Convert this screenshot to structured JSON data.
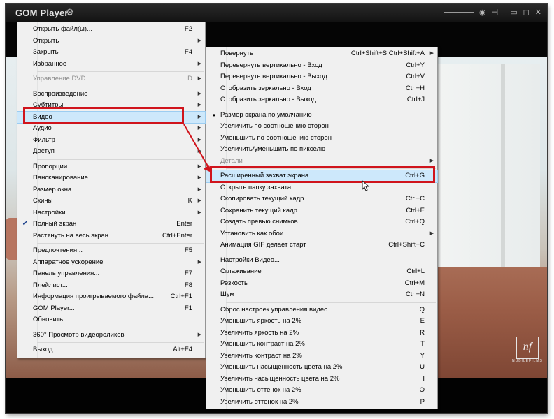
{
  "titlebar": {
    "app_title": "GOM Player",
    "settings_icon": "gear-icon",
    "controls": [
      "volume-slider",
      "audio-icon",
      "pin-icon",
      "minimize-icon",
      "maximize-icon",
      "close-icon"
    ]
  },
  "colors": {
    "annotation_red": "#d0141c",
    "menu_bg": "#f0f0f0",
    "highlight_bg": "#cde8fb"
  },
  "watermark": {
    "mark": "nf",
    "text": "NUBILEFILMS"
  },
  "main_menu": {
    "items": [
      {
        "label": "Открыть файл(ы)...",
        "shortcut": "F2"
      },
      {
        "label": "Открыть",
        "submenu": true
      },
      {
        "label": "Закрыть",
        "shortcut": "F4"
      },
      {
        "label": "Избранное",
        "submenu": true
      },
      {
        "separator": true
      },
      {
        "label": "Управление DVD",
        "shortcut": "D",
        "disabled": true,
        "submenu": true
      },
      {
        "separator": true
      },
      {
        "label": "Воспроизведение",
        "submenu": true
      },
      {
        "label": "Субтитры",
        "submenu": true
      },
      {
        "label": "Видео",
        "submenu": true,
        "highlighted": true
      },
      {
        "label": "Аудио",
        "submenu": true
      },
      {
        "label": "Фильтр",
        "submenu": true
      },
      {
        "label": "Доступ",
        "submenu": true
      },
      {
        "separator": true
      },
      {
        "label": "Пропорции",
        "submenu": true
      },
      {
        "label": "Пансканирование",
        "submenu": true
      },
      {
        "label": "Размер окна",
        "submenu": true
      },
      {
        "label": "Скины",
        "shortcut": "K",
        "submenu": true
      },
      {
        "label": "Настройки",
        "submenu": true
      },
      {
        "label": "Полный экран",
        "shortcut": "Enter",
        "checked": true
      },
      {
        "label": "Растянуть на весь экран",
        "shortcut": "Ctrl+Enter"
      },
      {
        "separator": true
      },
      {
        "label": "Предпочтения...",
        "shortcut": "F5"
      },
      {
        "label": "Аппаратное ускорение",
        "submenu": true
      },
      {
        "label": "Панель управления...",
        "shortcut": "F7"
      },
      {
        "label": "Плейлист...",
        "shortcut": "F8"
      },
      {
        "label": "Информация проигрываемого файла...",
        "shortcut": "Ctrl+F1"
      },
      {
        "label": "GOM Player...",
        "shortcut": "F1"
      },
      {
        "label": "Обновить"
      },
      {
        "separator": true
      },
      {
        "label": "360° Просмотр видеороликов",
        "submenu": true
      },
      {
        "separator": true
      },
      {
        "label": "Выход",
        "shortcut": "Alt+F4"
      }
    ]
  },
  "video_menu": {
    "items": [
      {
        "label": "Повернуть",
        "shortcut": "Ctrl+Shift+S,Ctrl+Shift+A",
        "submenu": true
      },
      {
        "label": "Перевернуть вертикально - Вход",
        "shortcut": "Ctrl+Y"
      },
      {
        "label": "Перевернуть вертикально - Выход",
        "shortcut": "Ctrl+V"
      },
      {
        "label": "Отобразить зеркально - Вход",
        "shortcut": "Ctrl+H"
      },
      {
        "label": "Отобразить зеркально - Выход",
        "shortcut": "Ctrl+J"
      },
      {
        "separator": true
      },
      {
        "label": "Размер экрана по умолчанию",
        "bullet": true
      },
      {
        "label": "Увеличить по соотношению сторон"
      },
      {
        "label": "Уменьшить по соотношению сторон"
      },
      {
        "label": "Увеличить/уменьшить по пикселю"
      },
      {
        "label": "Детали",
        "disabled": true,
        "submenu": true
      },
      {
        "separator": true
      },
      {
        "label": "Расширенный захват экрана...",
        "shortcut": "Ctrl+G",
        "highlighted": true
      },
      {
        "label": "Открыть папку захвата..."
      },
      {
        "label": "Скопировать текущий кадр",
        "shortcut": "Ctrl+C"
      },
      {
        "label": "Сохранить текущий кадр",
        "shortcut": "Ctrl+E"
      },
      {
        "label": "Создать превью снимков",
        "shortcut": "Ctrl+Q"
      },
      {
        "label": "Установить как обои",
        "submenu": true
      },
      {
        "label": "Анимация GIF делает старт",
        "shortcut": "Ctrl+Shift+C"
      },
      {
        "separator": true
      },
      {
        "label": "Настройки Видео..."
      },
      {
        "label": "Сглаживание",
        "shortcut": "Ctrl+L"
      },
      {
        "label": "Резкость",
        "shortcut": "Ctrl+M"
      },
      {
        "label": "Шум",
        "shortcut": "Ctrl+N"
      },
      {
        "separator": true
      },
      {
        "label": "Сброс настроек управления видео",
        "shortcut": "Q"
      },
      {
        "label": "Уменьшить яркость на 2%",
        "shortcut": "E"
      },
      {
        "label": "Увеличить яркость на 2%",
        "shortcut": "R"
      },
      {
        "label": "Уменьшить контраст на 2%",
        "shortcut": "T"
      },
      {
        "label": "Увеличить контраст на 2%",
        "shortcut": "Y"
      },
      {
        "label": "Уменьшить насыщенность цвета на 2%",
        "shortcut": "U"
      },
      {
        "label": "Увеличить насыщенность цвета на 2%",
        "shortcut": "I"
      },
      {
        "label": "Уменьшить оттенок на 2%",
        "shortcut": "O"
      },
      {
        "label": "Увеличить оттенок на 2%",
        "shortcut": "P"
      }
    ]
  }
}
